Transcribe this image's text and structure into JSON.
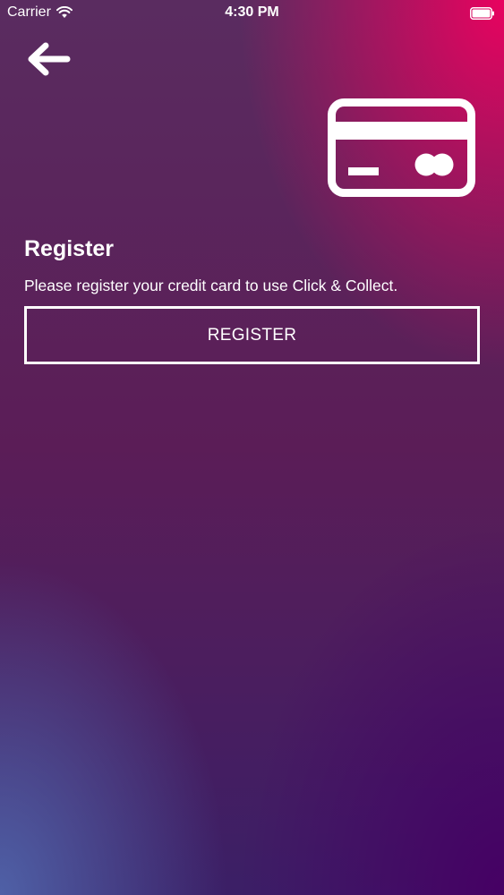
{
  "status_bar": {
    "carrier": "Carrier",
    "time": "4:30 PM",
    "wifi_icon": "wifi-icon",
    "battery_icon": "battery-icon"
  },
  "nav": {
    "back_icon": "arrow-left-icon"
  },
  "header_icon": "credit-card-icon",
  "register_section": {
    "title": "Register",
    "description": "Please register your credit card to use Click & Collect.",
    "button_label": "REGISTER"
  },
  "colors": {
    "text": "#ffffff",
    "accent_pink": "#f0005f",
    "accent_purple": "#460064",
    "accent_blue": "#5064aa"
  }
}
